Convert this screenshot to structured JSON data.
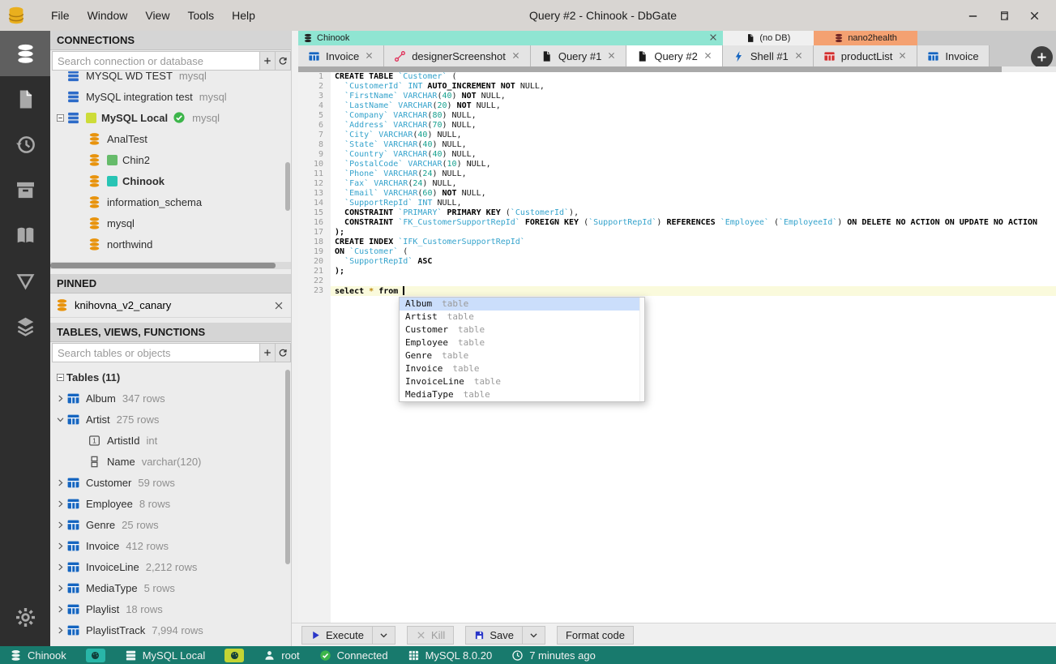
{
  "titlebar": {
    "title": "Query #2 - Chinook - DbGate",
    "menu": [
      "File",
      "Window",
      "View",
      "Tools",
      "Help"
    ]
  },
  "activity": [
    {
      "name": "connections",
      "icon": "db",
      "active": true
    },
    {
      "name": "files",
      "icon": "file"
    },
    {
      "name": "history",
      "icon": "history"
    },
    {
      "name": "archive",
      "icon": "archive"
    },
    {
      "name": "favorites",
      "icon": "book"
    },
    {
      "name": "query-designer",
      "icon": "funnel"
    },
    {
      "name": "plugins",
      "icon": "layers"
    },
    {
      "name": "settings",
      "icon": "gear",
      "bottom": true
    }
  ],
  "connections": {
    "header": "CONNECTIONS",
    "search_placeholder": "Search connection or database",
    "items": [
      {
        "label": "MYSQL WD TEST",
        "sub": "mysql",
        "icon": "server"
      },
      {
        "label": "MySQL integration test",
        "sub": "mysql",
        "icon": "server"
      },
      {
        "label": "MySQL Local",
        "sub": "mysql",
        "icon": "server",
        "bold": true,
        "expander": "minus",
        "square": "#cddc39",
        "check": true
      },
      {
        "label": "AnalTest",
        "icon": "db",
        "indent": 1
      },
      {
        "label": "Chin2",
        "icon": "db",
        "indent": 1,
        "square": "#66bb6a"
      },
      {
        "label": "Chinook",
        "icon": "db",
        "indent": 1,
        "bold": true,
        "square": "#28c4b4"
      },
      {
        "label": "information_schema",
        "icon": "db",
        "indent": 1
      },
      {
        "label": "mysql",
        "icon": "db",
        "indent": 1
      },
      {
        "label": "northwind",
        "icon": "db",
        "indent": 1
      }
    ]
  },
  "pinned": {
    "header": "PINNED",
    "item": "knihovna_v2_canary"
  },
  "tables": {
    "header": "TABLES, VIEWS, FUNCTIONS",
    "search_placeholder": "Search tables or objects",
    "items": [
      {
        "label": "Tables (11)",
        "bold": true,
        "expander": "minus"
      },
      {
        "label": "Album",
        "sub": "347 rows",
        "expander": "right",
        "icon": "table"
      },
      {
        "label": "Artist",
        "sub": "275 rows",
        "expander": "down",
        "icon": "table"
      },
      {
        "label": "ArtistId",
        "sub": "int",
        "icon": "pk",
        "indent": 1
      },
      {
        "label": "Name",
        "sub": "varchar(120)",
        "icon": "col",
        "indent": 1
      },
      {
        "label": "Customer",
        "sub": "59 rows",
        "expander": "right",
        "icon": "table"
      },
      {
        "label": "Employee",
        "sub": "8 rows",
        "expander": "right",
        "icon": "table"
      },
      {
        "label": "Genre",
        "sub": "25 rows",
        "expander": "right",
        "icon": "table"
      },
      {
        "label": "Invoice",
        "sub": "412 rows",
        "expander": "right",
        "icon": "table"
      },
      {
        "label": "InvoiceLine",
        "sub": "2,212 rows",
        "expander": "right",
        "icon": "table"
      },
      {
        "label": "MediaType",
        "sub": "5 rows",
        "expander": "right",
        "icon": "table"
      },
      {
        "label": "Playlist",
        "sub": "18 rows",
        "expander": "right",
        "icon": "table"
      },
      {
        "label": "PlaylistTrack",
        "sub": "7,994 rows",
        "expander": "right",
        "icon": "table"
      }
    ]
  },
  "tab_groups": [
    {
      "label": "Chinook",
      "icon": "db",
      "icon_color": "#222222",
      "bg": "#8fe5d2",
      "close": true,
      "tabs": [
        {
          "label": "Invoice",
          "icon": "table",
          "color": "#1565c0",
          "close": true
        },
        {
          "label": "designerScreenshot",
          "icon": "designer",
          "color": "#e0315a",
          "close": true
        },
        {
          "label": "Query #1",
          "icon": "file",
          "color": "#1b1b1b",
          "close": true
        },
        {
          "label": "Query #2",
          "icon": "file",
          "color": "#1b1b1b",
          "close": true,
          "active": true
        }
      ]
    },
    {
      "label": "(no DB)",
      "icon": "file",
      "icon_color": "#1b1b1b",
      "bg": "#f0f0f0",
      "tabs": [
        {
          "label": "Shell #1",
          "icon": "bolt",
          "color": "#1565c0",
          "close": true
        }
      ]
    },
    {
      "label": "nano2health",
      "icon": "db",
      "icon_color": "#6e2424",
      "bg": "#f4a171",
      "tabs": [
        {
          "label": "productList",
          "icon": "table",
          "color": "#d32f2f",
          "close": true
        }
      ]
    },
    {
      "label": "",
      "bg": "transparent",
      "tabs": [
        {
          "label": "Invoice",
          "icon": "table",
          "color": "#1565c0",
          "close": false
        }
      ]
    }
  ],
  "editor": {
    "active_line": 23,
    "lines": [
      [
        [
          "k",
          "CREATE TABLE "
        ],
        [
          "t",
          "`Customer`"
        ],
        [
          "p",
          " ("
        ]
      ],
      [
        [
          "p",
          "  "
        ],
        [
          "t",
          "`CustomerId`"
        ],
        [
          "p",
          " "
        ],
        [
          "t",
          "INT"
        ],
        [
          "p",
          " "
        ],
        [
          "k",
          "AUTO_INCREMENT"
        ],
        [
          "p",
          " "
        ],
        [
          "k",
          "NOT"
        ],
        [
          "p",
          " NULL,"
        ]
      ],
      [
        [
          "p",
          "  "
        ],
        [
          "t",
          "`FirstName`"
        ],
        [
          "p",
          " "
        ],
        [
          "t",
          "VARCHAR"
        ],
        [
          "p",
          "("
        ],
        [
          "n",
          "40"
        ],
        [
          "p",
          ") "
        ],
        [
          "k",
          "NOT"
        ],
        [
          "p",
          " NULL,"
        ]
      ],
      [
        [
          "p",
          "  "
        ],
        [
          "t",
          "`LastName`"
        ],
        [
          "p",
          " "
        ],
        [
          "t",
          "VARCHAR"
        ],
        [
          "p",
          "("
        ],
        [
          "n",
          "20"
        ],
        [
          "p",
          ") "
        ],
        [
          "k",
          "NOT"
        ],
        [
          "p",
          " NULL,"
        ]
      ],
      [
        [
          "p",
          "  "
        ],
        [
          "t",
          "`Company`"
        ],
        [
          "p",
          " "
        ],
        [
          "t",
          "VARCHAR"
        ],
        [
          "p",
          "("
        ],
        [
          "n",
          "80"
        ],
        [
          "p",
          ") NULL,"
        ]
      ],
      [
        [
          "p",
          "  "
        ],
        [
          "t",
          "`Address`"
        ],
        [
          "p",
          " "
        ],
        [
          "t",
          "VARCHAR"
        ],
        [
          "p",
          "("
        ],
        [
          "n",
          "70"
        ],
        [
          "p",
          ") NULL,"
        ]
      ],
      [
        [
          "p",
          "  "
        ],
        [
          "t",
          "`City`"
        ],
        [
          "p",
          " "
        ],
        [
          "t",
          "VARCHAR"
        ],
        [
          "p",
          "("
        ],
        [
          "n",
          "40"
        ],
        [
          "p",
          ") NULL,"
        ]
      ],
      [
        [
          "p",
          "  "
        ],
        [
          "t",
          "`State`"
        ],
        [
          "p",
          " "
        ],
        [
          "t",
          "VARCHAR"
        ],
        [
          "p",
          "("
        ],
        [
          "n",
          "40"
        ],
        [
          "p",
          ") NULL,"
        ]
      ],
      [
        [
          "p",
          "  "
        ],
        [
          "t",
          "`Country`"
        ],
        [
          "p",
          " "
        ],
        [
          "t",
          "VARCHAR"
        ],
        [
          "p",
          "("
        ],
        [
          "n",
          "40"
        ],
        [
          "p",
          ") NULL,"
        ]
      ],
      [
        [
          "p",
          "  "
        ],
        [
          "t",
          "`PostalCode`"
        ],
        [
          "p",
          " "
        ],
        [
          "t",
          "VARCHAR"
        ],
        [
          "p",
          "("
        ],
        [
          "n",
          "10"
        ],
        [
          "p",
          ") NULL,"
        ]
      ],
      [
        [
          "p",
          "  "
        ],
        [
          "t",
          "`Phone`"
        ],
        [
          "p",
          " "
        ],
        [
          "t",
          "VARCHAR"
        ],
        [
          "p",
          "("
        ],
        [
          "n",
          "24"
        ],
        [
          "p",
          ") NULL,"
        ]
      ],
      [
        [
          "p",
          "  "
        ],
        [
          "t",
          "`Fax`"
        ],
        [
          "p",
          " "
        ],
        [
          "t",
          "VARCHAR"
        ],
        [
          "p",
          "("
        ],
        [
          "n",
          "24"
        ],
        [
          "p",
          ") NULL,"
        ]
      ],
      [
        [
          "p",
          "  "
        ],
        [
          "t",
          "`Email`"
        ],
        [
          "p",
          " "
        ],
        [
          "t",
          "VARCHAR"
        ],
        [
          "p",
          "("
        ],
        [
          "n",
          "60"
        ],
        [
          "p",
          ") "
        ],
        [
          "k",
          "NOT"
        ],
        [
          "p",
          " NULL,"
        ]
      ],
      [
        [
          "p",
          "  "
        ],
        [
          "t",
          "`SupportRepId`"
        ],
        [
          "p",
          " "
        ],
        [
          "t",
          "INT"
        ],
        [
          "p",
          " NULL,"
        ]
      ],
      [
        [
          "p",
          "  "
        ],
        [
          "k",
          "CONSTRAINT"
        ],
        [
          "p",
          " "
        ],
        [
          "t",
          "`PRIMARY`"
        ],
        [
          "p",
          " "
        ],
        [
          "k",
          "PRIMARY KEY"
        ],
        [
          "p",
          " ("
        ],
        [
          "t",
          "`CustomerId`"
        ],
        [
          "p",
          "),"
        ]
      ],
      [
        [
          "p",
          "  "
        ],
        [
          "k",
          "CONSTRAINT"
        ],
        [
          "p",
          " "
        ],
        [
          "t",
          "`FK_CustomerSupportRepId`"
        ],
        [
          "p",
          " "
        ],
        [
          "k",
          "FOREIGN KEY"
        ],
        [
          "p",
          " ("
        ],
        [
          "t",
          "`SupportRepId`"
        ],
        [
          "p",
          ") "
        ],
        [
          "k",
          "REFERENCES"
        ],
        [
          "p",
          " "
        ],
        [
          "t",
          "`Employee`"
        ],
        [
          "p",
          " ("
        ],
        [
          "t",
          "`EmployeeId`"
        ],
        [
          "p",
          ") "
        ],
        [
          "k",
          "ON DELETE NO ACTION ON UPDATE NO ACTION"
        ]
      ],
      [
        [
          "k",
          ");"
        ]
      ],
      [
        [
          "k",
          "CREATE INDEX "
        ],
        [
          "t",
          "`IFK_CustomerSupportRepId`"
        ]
      ],
      [
        [
          "k",
          "ON "
        ],
        [
          "t",
          "`Customer`"
        ],
        [
          "p",
          " ("
        ]
      ],
      [
        [
          "p",
          "  "
        ],
        [
          "t",
          "`SupportRepId`"
        ],
        [
          "p",
          " "
        ],
        [
          "k",
          "ASC"
        ]
      ],
      [
        [
          "k",
          ");"
        ]
      ],
      [],
      [
        [
          "k",
          "select"
        ],
        [
          "p",
          " "
        ],
        [
          "o",
          "*"
        ],
        [
          "p",
          " "
        ],
        [
          "k",
          "from"
        ],
        [
          "p",
          " "
        ]
      ]
    ]
  },
  "autocomplete": {
    "selected": 0,
    "items": [
      {
        "name": "Album",
        "kind": "table"
      },
      {
        "name": "Artist",
        "kind": "table"
      },
      {
        "name": "Customer",
        "kind": "table"
      },
      {
        "name": "Employee",
        "kind": "table"
      },
      {
        "name": "Genre",
        "kind": "table"
      },
      {
        "name": "Invoice",
        "kind": "table"
      },
      {
        "name": "InvoiceLine",
        "kind": "table"
      },
      {
        "name": "MediaType",
        "kind": "table"
      }
    ]
  },
  "toolbar": {
    "buttons": [
      {
        "label": "Execute",
        "icon": "play",
        "chevron": true
      },
      {
        "label": "Kill",
        "icon": "x",
        "disabled": true
      },
      {
        "label": "Save",
        "icon": "save",
        "chevron": true
      },
      {
        "label": "Format code"
      }
    ]
  },
  "statusbar": {
    "bg": "#187a6d",
    "items": [
      {
        "icon": "db",
        "label": "Chinook",
        "name": "status-database",
        "click": true
      },
      {
        "badge": "#29b6a8",
        "name": "status-theme-connection"
      },
      {
        "icon": "server",
        "label": "MySQL Local",
        "name": "status-connection",
        "click": true
      },
      {
        "badge": "#c3d434",
        "name": "status-theme-database"
      },
      {
        "icon": "person",
        "label": "root",
        "name": "status-user"
      },
      {
        "icon": "check",
        "label": "Connected",
        "name": "status-connected"
      },
      {
        "icon": "grid",
        "label": "MySQL 8.0.20",
        "name": "status-version"
      },
      {
        "icon": "clock",
        "label": "7 minutes ago",
        "name": "status-last-query"
      }
    ]
  }
}
